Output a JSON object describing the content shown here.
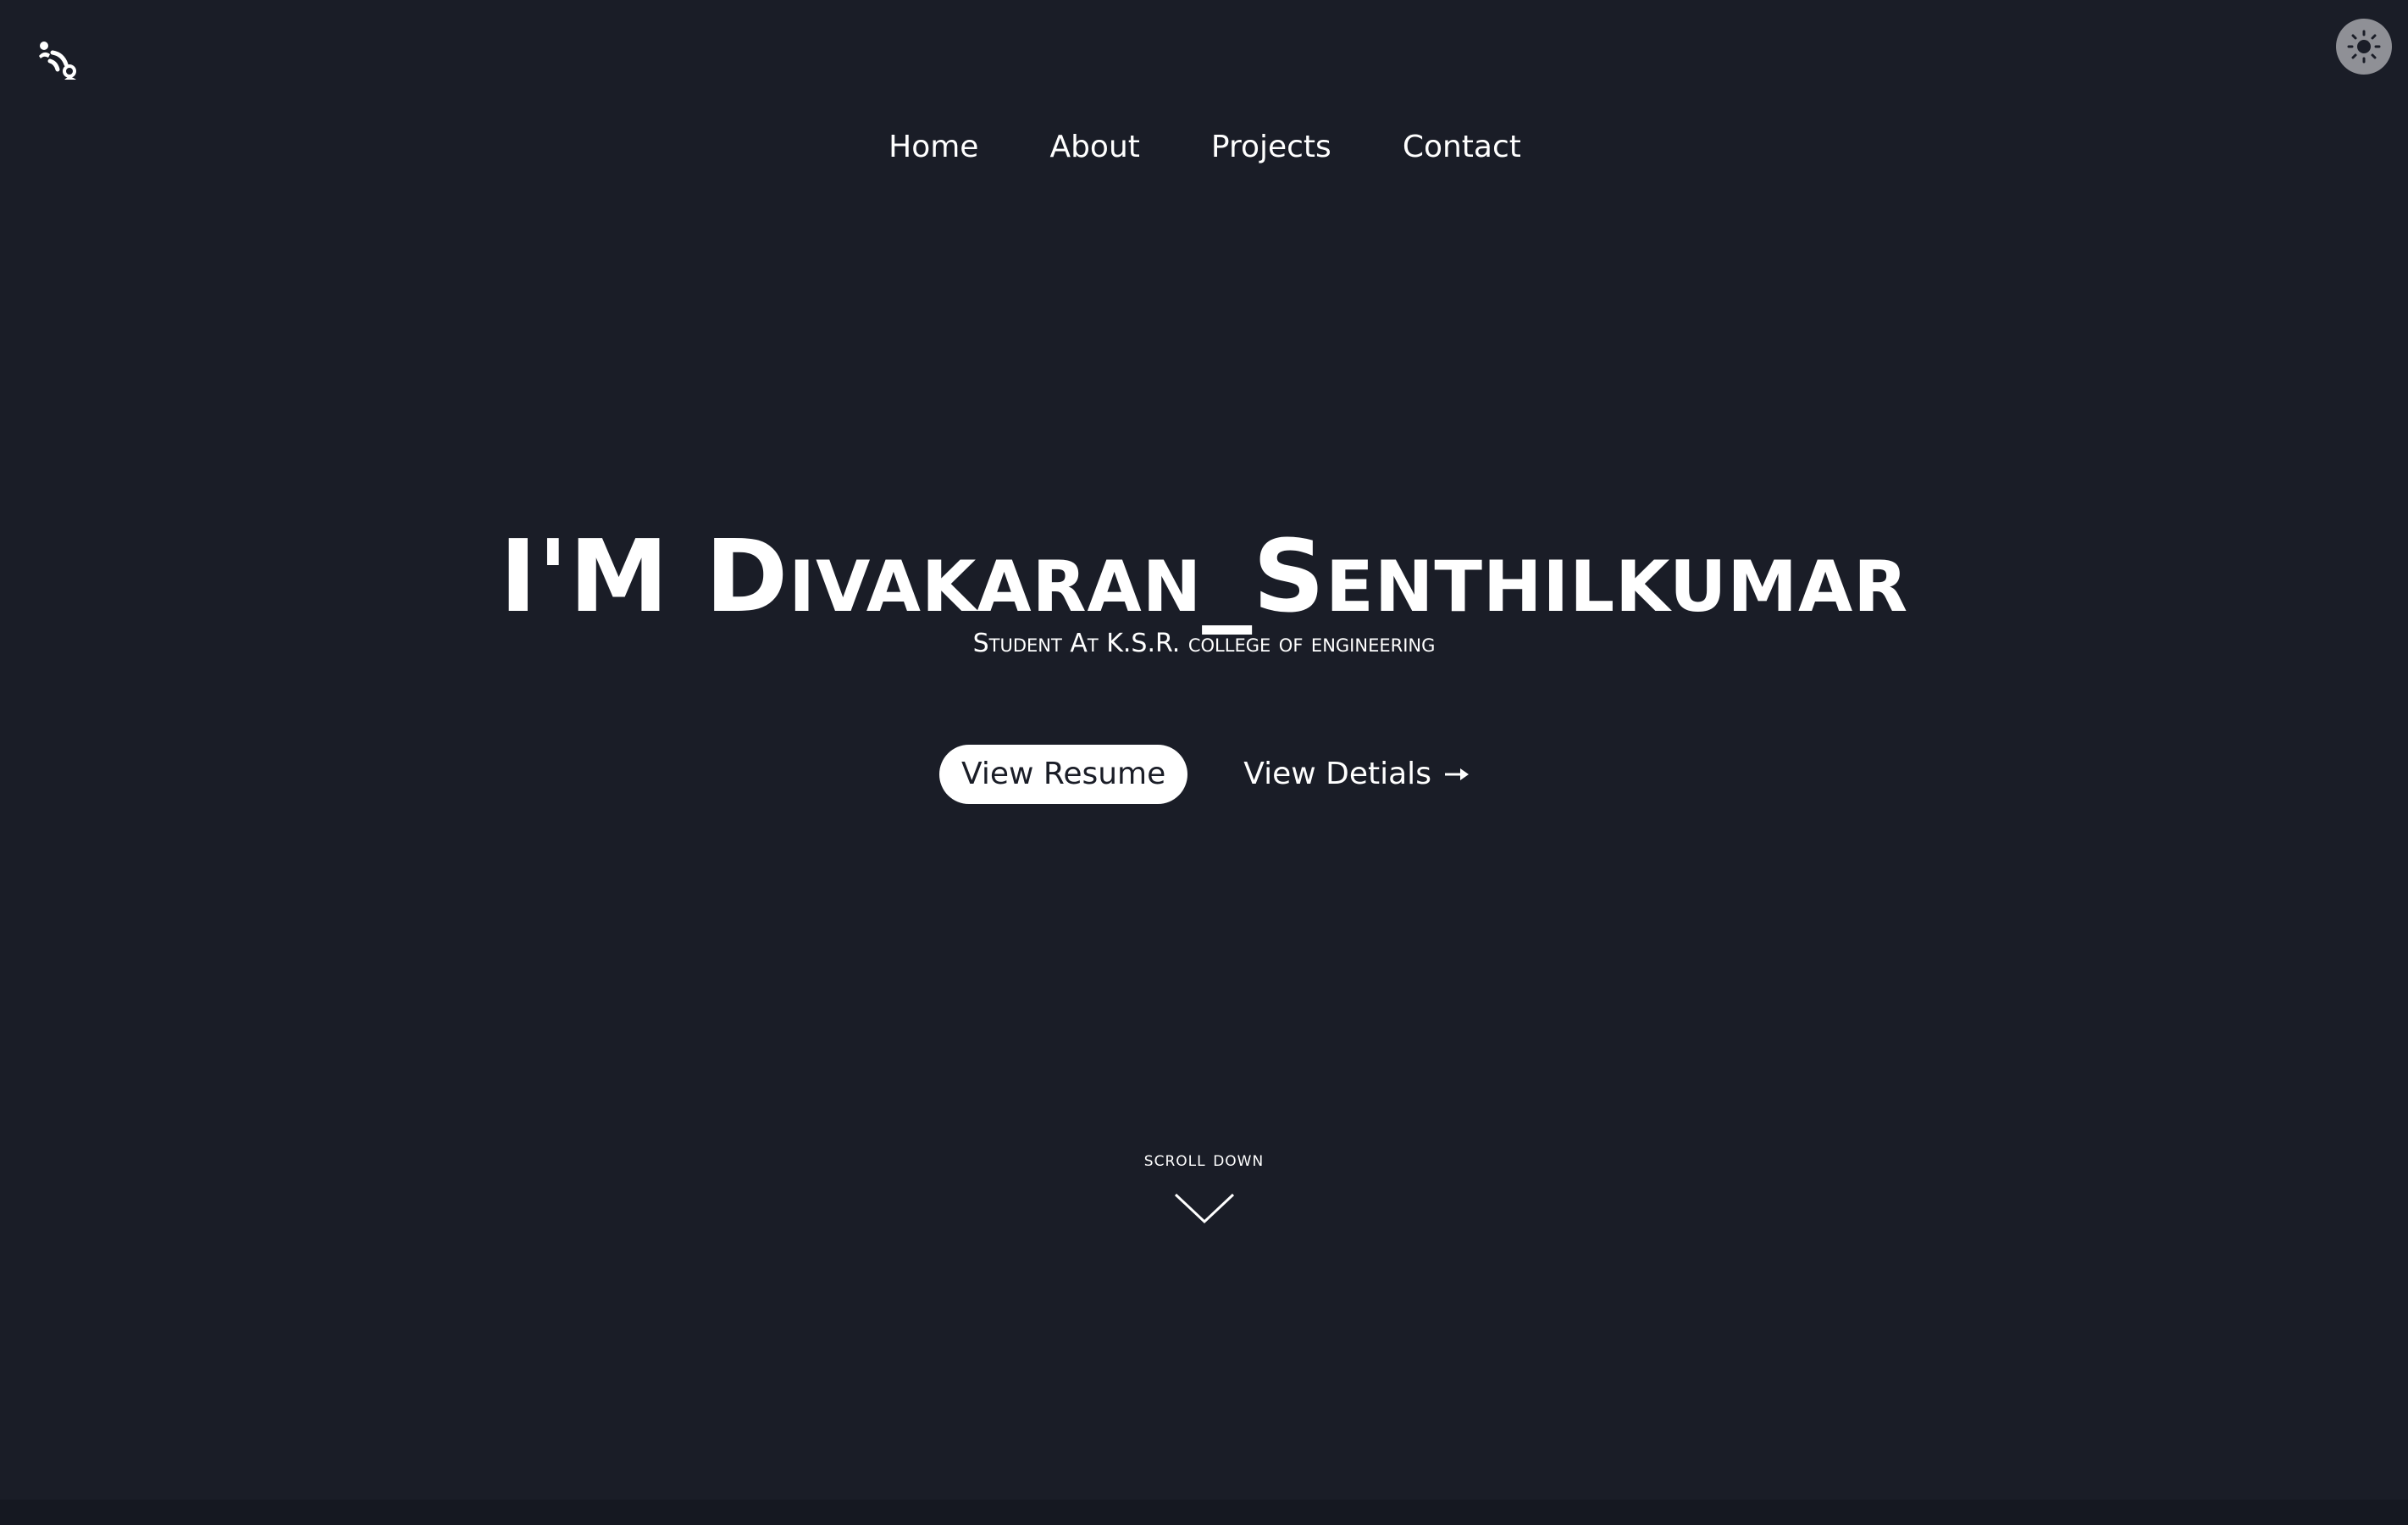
{
  "nav": {
    "items": [
      {
        "label": "Home"
      },
      {
        "label": "About"
      },
      {
        "label": "Projects"
      },
      {
        "label": "Contact"
      }
    ]
  },
  "header": {
    "logo_icon": "user-wifi-logo-icon",
    "theme_toggle_icon": "sun-icon"
  },
  "hero": {
    "title": "I'M Divakaran_Senthilkumar",
    "subtitle": "Student At K.S.R. college of engineering",
    "primary_button_label": "View Resume",
    "secondary_button_label": "View Detials",
    "secondary_button_icon": "arrow-right-icon"
  },
  "scroll": {
    "label": "scroll down",
    "icon": "chevron-down-icon"
  },
  "colors": {
    "background": "#1a1d27",
    "text": "#ffffff",
    "toggle_bg": "#8f9096",
    "button_bg": "#ffffff",
    "button_text": "#1a1d27"
  }
}
